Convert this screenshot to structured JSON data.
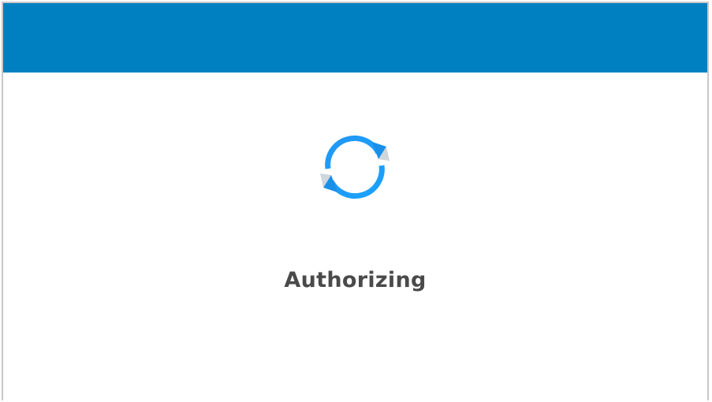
{
  "header": {
    "color": "#0080c0"
  },
  "status": {
    "text": "Authorizing",
    "icon": "sync-arrows-icon",
    "color": "#4a4a4a",
    "spinner_color": "#1e90ff"
  }
}
